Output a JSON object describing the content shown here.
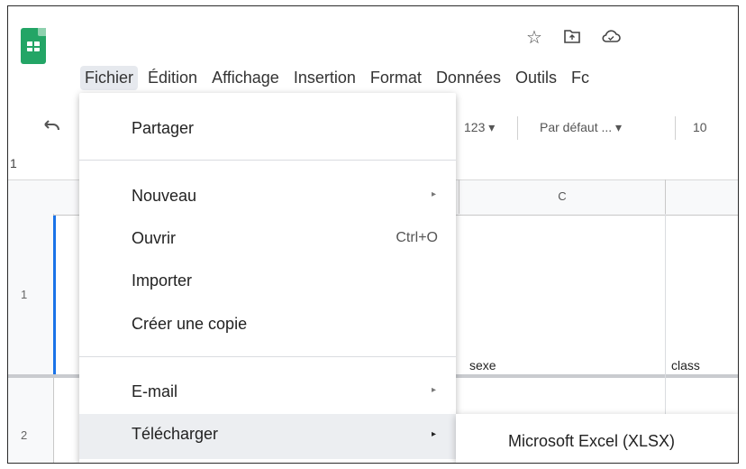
{
  "app": {
    "logo_icon": "google-sheets-logo",
    "title_icons": [
      "star-icon",
      "move-to-folder-icon",
      "cloud-status-icon"
    ]
  },
  "menubar": {
    "items": [
      "Fichier",
      "Édition",
      "Affichage",
      "Insertion",
      "Format",
      "Données",
      "Outils",
      "Fc"
    ],
    "active": "Fichier"
  },
  "toolbar": {
    "undo_icon": "undo-icon",
    "number_format": "123 ▾",
    "font": "Par défaut ...  ▾",
    "font_size": "10"
  },
  "formula_bar": {
    "cell_ref": "1"
  },
  "grid": {
    "column_headers": [
      "C"
    ],
    "row_numbers": [
      "1",
      "2"
    ],
    "cells": {
      "C1": "sexe",
      "D1": "class"
    }
  },
  "file_menu": {
    "items": [
      {
        "label": "Partager"
      },
      {
        "label": "Nouveau",
        "submenu": true
      },
      {
        "label": "Ouvrir",
        "shortcut": "Ctrl+O"
      },
      {
        "label": "Importer"
      },
      {
        "label": "Créer une copie"
      },
      {
        "label": "E-mail",
        "submenu": true
      },
      {
        "label": "Télécharger",
        "submenu": true,
        "highlighted": true
      }
    ],
    "submenu_arrow": "▸"
  },
  "download_submenu": {
    "items": [
      "Microsoft Excel (XLSX)"
    ]
  },
  "colors": {
    "sheets_green": "#23a566",
    "selection_blue": "#1a73e8",
    "menu_highlight": "#eceef1"
  }
}
